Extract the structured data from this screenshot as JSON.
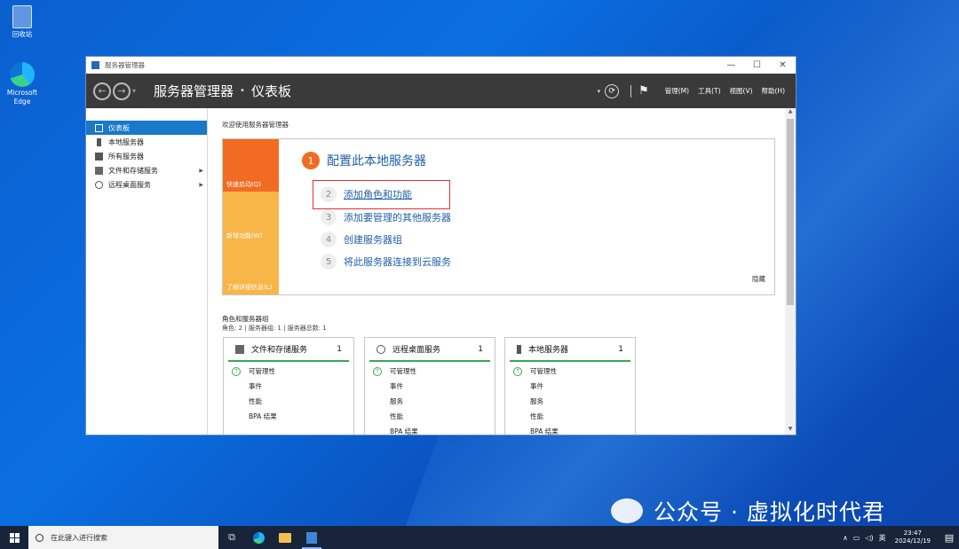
{
  "desktop": {
    "icons": [
      {
        "name": "recycle-bin",
        "label": "回收站"
      },
      {
        "name": "microsoft-edge",
        "label": "Microsoft Edge"
      }
    ]
  },
  "window": {
    "title": "服务器管理器",
    "controls": {
      "minimize": "—",
      "maximize": "☐",
      "close": "✕"
    },
    "breadcrumb": {
      "root": "服务器管理器",
      "separator": "•",
      "current": "仪表板"
    },
    "menu": [
      "管理(M)",
      "工具(T)",
      "视图(V)",
      "帮助(H)"
    ]
  },
  "sidebar": {
    "items": [
      {
        "label": "仪表板",
        "active": true
      },
      {
        "label": "本地服务器"
      },
      {
        "label": "所有服务器"
      },
      {
        "label": "文件和存储服务",
        "expandable": true
      },
      {
        "label": "远程桌面服务",
        "expandable": true
      }
    ]
  },
  "welcome": {
    "title": "欢迎使用服务器管理器",
    "tiles": [
      "快速启动(Q)",
      "新增功能(W)",
      "了解详细信息(L)"
    ],
    "steps": [
      {
        "num": "1",
        "label": "配置此本地服务器"
      },
      {
        "num": "2",
        "label": "添加角色和功能"
      },
      {
        "num": "3",
        "label": "添加要管理的其他服务器"
      },
      {
        "num": "4",
        "label": "创建服务器组"
      },
      {
        "num": "5",
        "label": "将此服务器连接到云服务"
      }
    ],
    "hide": "隐藏"
  },
  "roles": {
    "title": "角色和服务器组",
    "subtitle": "角色: 2 | 服务器组: 1 | 服务器总数: 1",
    "cards": [
      {
        "name": "文件和存储服务",
        "count": "1",
        "rows": [
          "可管理性",
          "事件",
          "性能",
          "BPA 结果"
        ]
      },
      {
        "name": "远程桌面服务",
        "count": "1",
        "rows": [
          "可管理性",
          "事件",
          "服务",
          "性能",
          "BPA 结果"
        ]
      },
      {
        "name": "本地服务器",
        "count": "1",
        "rows": [
          "可管理性",
          "事件",
          "服务",
          "性能",
          "BPA 结果"
        ]
      }
    ]
  },
  "watermark": "公众号 · 虚拟化时代君",
  "taskbar": {
    "search_placeholder": "在此键入进行搜索",
    "tray_lang": "英",
    "time": "23:47",
    "date": "2024/12/19"
  },
  "colors": {
    "accent_blue": "#1979ca",
    "quickstart_orange": "#f26b22",
    "tile_yellow": "#f8b548",
    "status_green": "#39a852",
    "highlight_red": "#e03030"
  }
}
